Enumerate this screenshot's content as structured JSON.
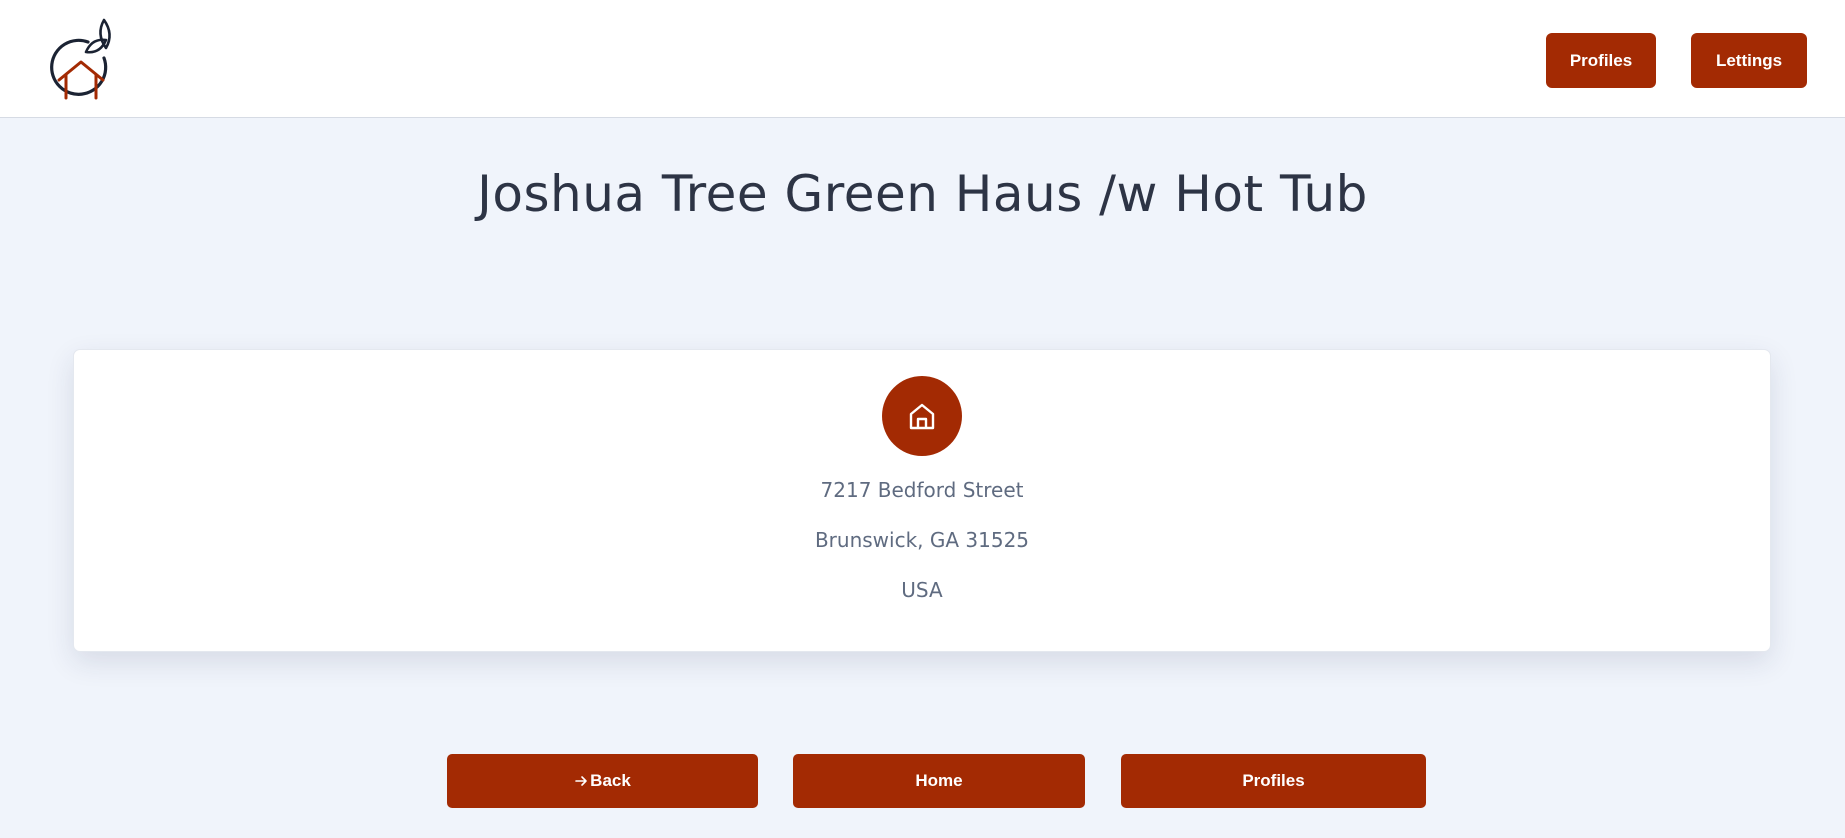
{
  "header": {
    "logo_icon": "house-with-leaves-logo",
    "nav": [
      {
        "label": "Profiles"
      },
      {
        "label": "Lettings"
      }
    ]
  },
  "main": {
    "title": "Joshua Tree Green Haus /w Hot Tub",
    "address": {
      "icon": "home-icon",
      "street": "7217 Bedford Street",
      "city_line": "Brunswick, GA 31525",
      "country": "USA"
    }
  },
  "footer_buttons": {
    "back": {
      "label": "Back",
      "icon": "arrow-right-icon"
    },
    "home": {
      "label": "Home"
    },
    "profiles": {
      "label": "Profiles"
    }
  },
  "colors": {
    "accent": "#a32a03",
    "background": "#f0f4fb",
    "text_dark": "#2d3445",
    "text_muted": "#5f6b80"
  }
}
